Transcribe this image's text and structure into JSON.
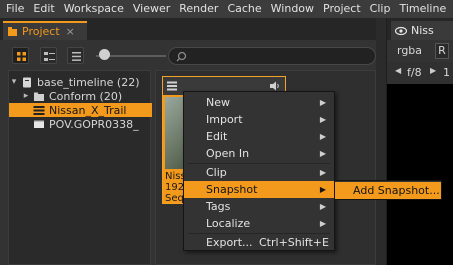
{
  "menubar": [
    "File",
    "Edit",
    "Workspace",
    "Viewer",
    "Render",
    "Cache",
    "Window",
    "Project",
    "Clip",
    "Timeline"
  ],
  "project_panel": {
    "tab_label": "Project",
    "close_glyph": "×"
  },
  "tree": [
    {
      "label": "base_timeline (22)",
      "expander": "▾",
      "icon": "timeline-icon"
    },
    {
      "label": "Conform (20)",
      "expander": "▸",
      "icon": "folder-icon"
    },
    {
      "label": "Nissan_X_Trail",
      "expander": "",
      "icon": "sequence-icon",
      "selected": true
    },
    {
      "label": "POV.GOPR0338_",
      "expander": "",
      "icon": "clip-icon"
    }
  ],
  "clip_card": {
    "line1": "Niss",
    "line2": "192",
    "line3": "Sequ"
  },
  "viewer": {
    "tab_label": "Niss",
    "channel": "rgba",
    "channel_extra": "R",
    "fstop": "f/8",
    "one": "1"
  },
  "context_menu": [
    {
      "label": "New",
      "arrow": true
    },
    {
      "label": "Import",
      "arrow": true
    },
    {
      "label": "Edit",
      "arrow": true
    },
    {
      "label": "Open In",
      "arrow": true
    },
    {
      "label": "Clip",
      "arrow": true
    },
    {
      "label": "Snapshot",
      "arrow": true,
      "highlighted": true
    },
    {
      "label": "Tags",
      "arrow": true
    },
    {
      "label": "Localize",
      "arrow": true
    },
    {
      "label": "Export...",
      "shortcut": "Ctrl+Shift+E"
    }
  ],
  "submenu": {
    "label": "Add Snapshot..."
  },
  "colors": {
    "accent": "#f39a1d",
    "panel": "#333333",
    "menubar": "#3c3c3c"
  }
}
